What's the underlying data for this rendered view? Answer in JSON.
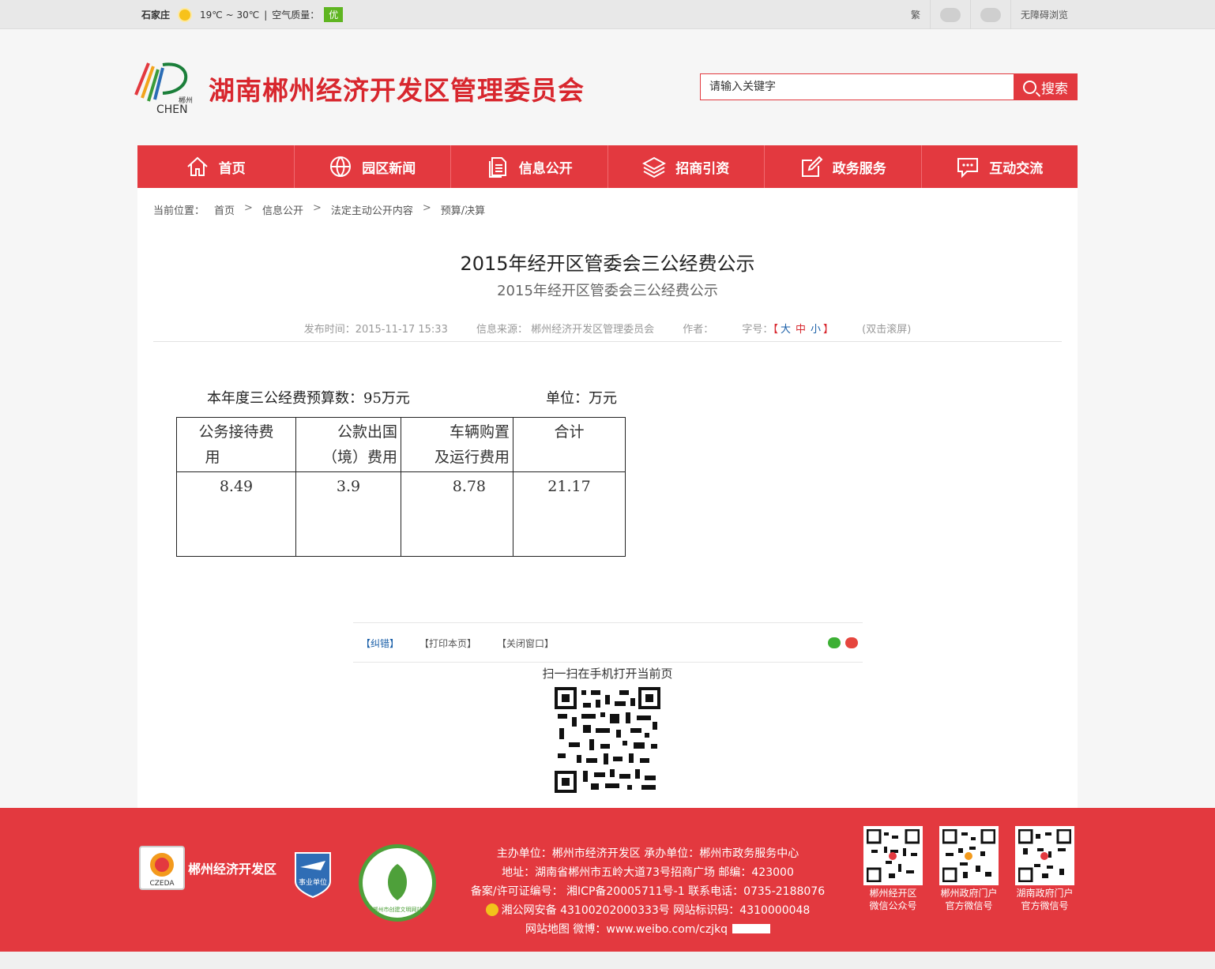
{
  "topbar": {
    "city": "石家庄",
    "temperature": "19℃ ~ 30℃",
    "air_quality_label": "空气质量：",
    "air_quality_value": "优",
    "traditional": "繁",
    "accessibility": "无障碍浏览"
  },
  "header": {
    "logo_text": "郴州",
    "logo_sub": "CHEN",
    "site_title": "湖南郴州经济开发区管理委员会",
    "search_placeholder": "请输入关键字",
    "search_button": "搜索"
  },
  "nav": [
    {
      "label": "首页",
      "icon": "home-icon"
    },
    {
      "label": "园区新闻",
      "icon": "globe-icon"
    },
    {
      "label": "信息公开",
      "icon": "document-icon"
    },
    {
      "label": "招商引资",
      "icon": "layers-icon"
    },
    {
      "label": "政务服务",
      "icon": "edit-icon"
    },
    {
      "label": "互动交流",
      "icon": "chat-icon"
    }
  ],
  "breadcrumb": {
    "prefix": "当前位置：",
    "items": [
      "首页",
      "信息公开",
      "法定主动公开内容",
      "预算/决算"
    ],
    "separator": ">"
  },
  "article": {
    "title": "2015年经开区管委会三公经费公示",
    "subtitle": "2015年经开区管委会三公经费公示",
    "publish_time": "发布时间：2015-11-17 15:33",
    "source": "信息来源： 郴州经济开发区管理委员会",
    "author": "作者：",
    "font_size_label": "字号：",
    "font_large": "大",
    "font_medium": "中",
    "font_small": "小",
    "bracket_open": "【",
    "bracket_close": "】",
    "scroll_hint": "(双击滚屏)",
    "budget_text": "本年度三公经费预算数：95万元",
    "unit_text": "单位：万元",
    "table": {
      "headers": [
        [
          "公务接待费",
          "用"
        ],
        [
          "公款出国",
          "（境）费用"
        ],
        [
          "车辆购置",
          "及运行费用"
        ],
        [
          "合计",
          ""
        ]
      ],
      "values": [
        "8.49",
        "3.9",
        "8.78",
        "21.17"
      ]
    }
  },
  "tools": {
    "correct": "【纠错】",
    "print": "【打印本页】",
    "close": "【关闭窗口】",
    "scan_text": "扫一扫在手机打开当前页"
  },
  "footer": {
    "org_name": "郴州经济开发区",
    "logo_abbr": "CZEDA",
    "badge_text": "事业单位",
    "circle_text": "郴州市创建文明网站",
    "line1": "主办单位：郴州市经济开发区    承办单位：郴州市政务服务中心",
    "line2": "地址：湖南省郴州市五岭大道73号招商广场    邮编：423000",
    "line3": "备案/许可证编号： 湘ICP备20005711号-1 联系电话：0735-2188076",
    "line4": "湘公网安备 43100202000333号 网站标识码：4310000048",
    "line5": "网站地图 微博：www.weibo.com/czjkq",
    "qrcodes": [
      {
        "line1": "郴州经开区",
        "line2": "微信公众号"
      },
      {
        "line1": "郴州政府门户",
        "line2": "官方微信号"
      },
      {
        "line1": "湖南政府门户",
        "line2": "官方微信号"
      }
    ]
  },
  "colors": {
    "brand_red": "#e3393f",
    "title_red": "#d8272e",
    "link_blue": "#1a5fa8",
    "aq_green": "#5fb521"
  }
}
